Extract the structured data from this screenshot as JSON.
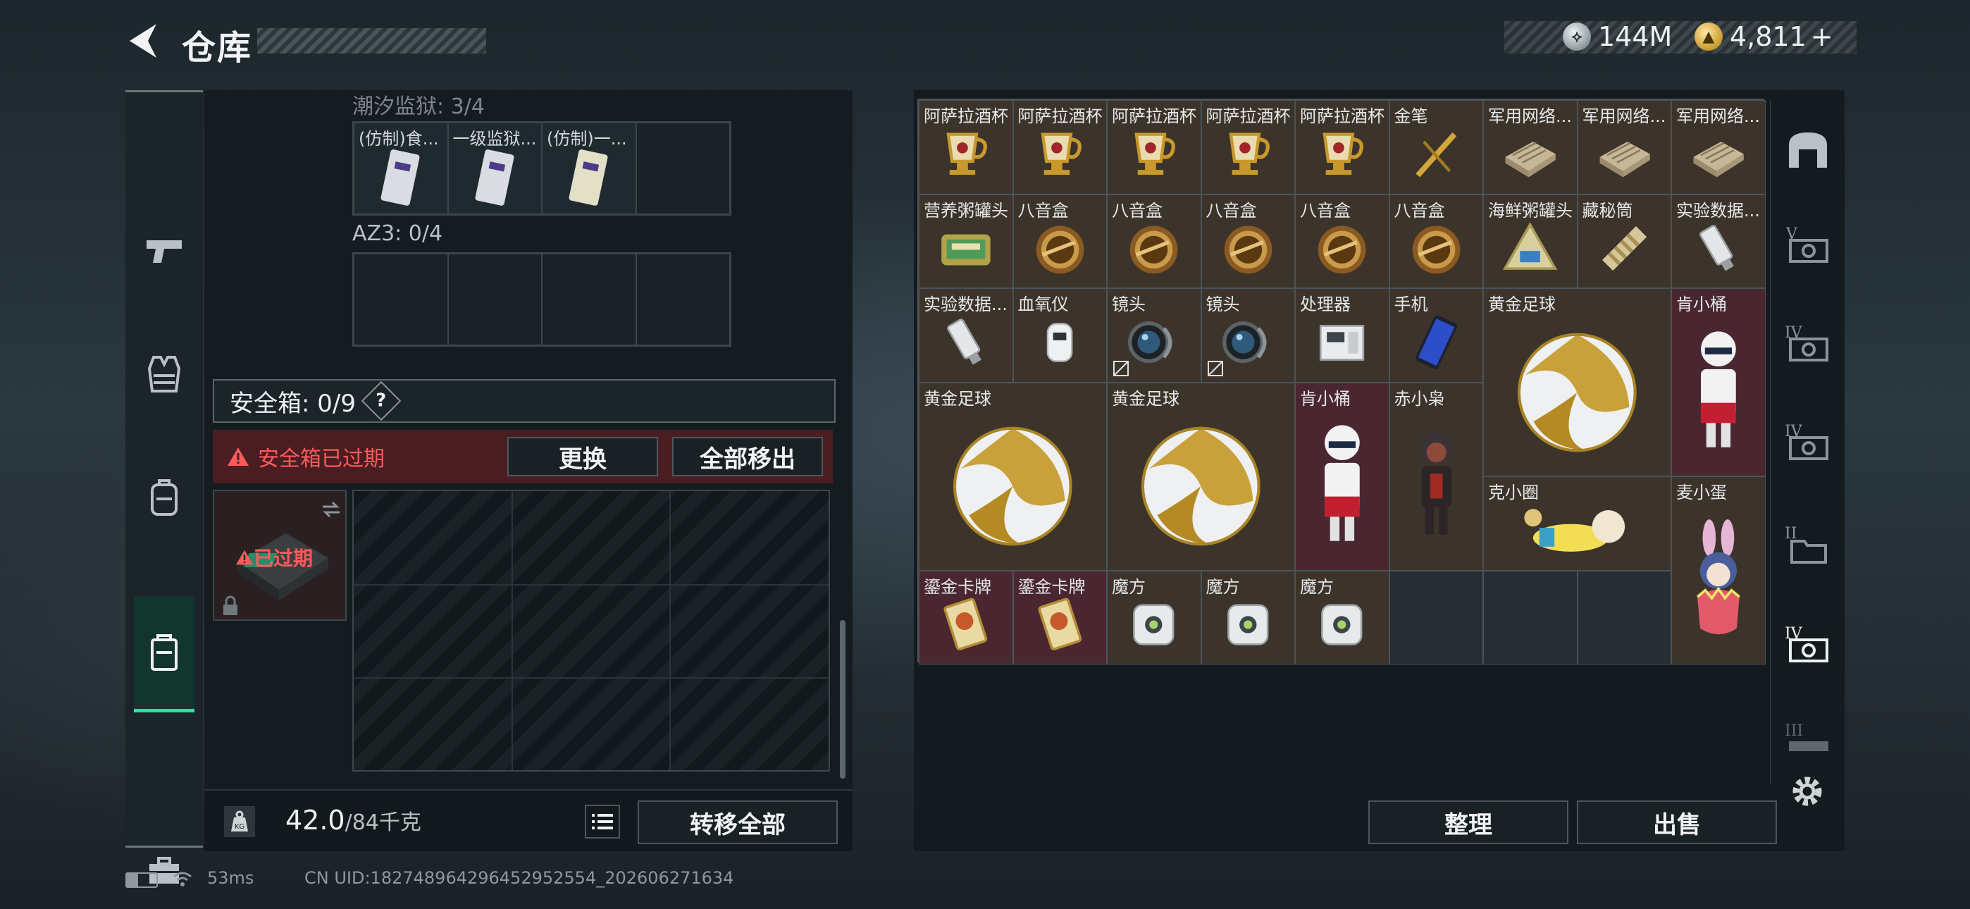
{
  "header": {
    "title": "仓库",
    "currency": [
      {
        "value": "144M"
      },
      {
        "value": "4,811"
      }
    ],
    "add_symbol": "+"
  },
  "left": {
    "tidal_label": "潮汐监狱: 3/4",
    "tidal_items": [
      {
        "label": "(仿制)食..."
      },
      {
        "label": "一级监狱..."
      },
      {
        "label": "(仿制)一..."
      },
      {
        "label": ""
      }
    ],
    "az3_label": "AZ3: 0/4",
    "safebox_label": "安全箱: 0/9",
    "safebox_help": "?",
    "expired_warning": "安全箱已过期",
    "replace_button": "更换",
    "move_all_button": "全部移出",
    "expired_tag": "已过期",
    "weight_value": "42.0",
    "weight_max": "/84千克",
    "transfer_all_button": "转移全部"
  },
  "right": {
    "items": [
      {
        "label": "阿萨拉酒杯",
        "col": 1,
        "row": 1,
        "w": 1,
        "h": 1,
        "bg": "gold",
        "icon": "goblet"
      },
      {
        "label": "阿萨拉酒杯",
        "col": 2,
        "row": 1,
        "w": 1,
        "h": 1,
        "bg": "gold",
        "icon": "goblet"
      },
      {
        "label": "阿萨拉酒杯",
        "col": 3,
        "row": 1,
        "w": 1,
        "h": 1,
        "bg": "gold",
        "icon": "goblet"
      },
      {
        "label": "阿萨拉酒杯",
        "col": 4,
        "row": 1,
        "w": 1,
        "h": 1,
        "bg": "gold",
        "icon": "goblet"
      },
      {
        "label": "阿萨拉酒杯",
        "col": 5,
        "row": 1,
        "w": 1,
        "h": 1,
        "bg": "gold",
        "icon": "goblet"
      },
      {
        "label": "金笔",
        "col": 6,
        "row": 1,
        "w": 1,
        "h": 1,
        "bg": "gold",
        "icon": "pen"
      },
      {
        "label": "军用网络...",
        "col": 7,
        "row": 1,
        "w": 1,
        "h": 1,
        "bg": "gold",
        "icon": "router"
      },
      {
        "label": "军用网络...",
        "col": 8,
        "row": 1,
        "w": 1,
        "h": 1,
        "bg": "gold",
        "icon": "router"
      },
      {
        "label": "军用网络...",
        "col": 9,
        "row": 1,
        "w": 1,
        "h": 1,
        "bg": "gold",
        "icon": "router"
      },
      {
        "label": "营养粥罐头",
        "col": 1,
        "row": 2,
        "w": 1,
        "h": 1,
        "bg": "gold",
        "icon": "can"
      },
      {
        "label": "八音盒",
        "col": 2,
        "row": 2,
        "w": 1,
        "h": 1,
        "bg": "gold",
        "icon": "musicbox"
      },
      {
        "label": "八音盒",
        "col": 3,
        "row": 2,
        "w": 1,
        "h": 1,
        "bg": "gold",
        "icon": "musicbox"
      },
      {
        "label": "八音盒",
        "col": 4,
        "row": 2,
        "w": 1,
        "h": 1,
        "bg": "gold",
        "icon": "musicbox"
      },
      {
        "label": "八音盒",
        "col": 5,
        "row": 2,
        "w": 1,
        "h": 1,
        "bg": "gold",
        "icon": "musicbox"
      },
      {
        "label": "八音盒",
        "col": 6,
        "row": 2,
        "w": 1,
        "h": 1,
        "bg": "gold",
        "icon": "musicbox"
      },
      {
        "label": "海鲜粥罐头",
        "col": 7,
        "row": 2,
        "w": 1,
        "h": 1,
        "bg": "gold",
        "icon": "pyramid"
      },
      {
        "label": "藏秘筒",
        "col": 8,
        "row": 2,
        "w": 1,
        "h": 1,
        "bg": "gold",
        "icon": "cryptex"
      },
      {
        "label": "实验数据...",
        "col": 9,
        "row": 2,
        "w": 1,
        "h": 1,
        "bg": "gold",
        "icon": "usb"
      },
      {
        "label": "实验数据...",
        "col": 1,
        "row": 3,
        "w": 1,
        "h": 1,
        "bg": "gold",
        "icon": "usb"
      },
      {
        "label": "血氧仪",
        "col": 2,
        "row": 3,
        "w": 1,
        "h": 1,
        "bg": "gold",
        "icon": "oximeter"
      },
      {
        "label": "镜头",
        "col": 3,
        "row": 3,
        "w": 1,
        "h": 1,
        "bg": "gold",
        "icon": "lens"
      },
      {
        "label": "镜头",
        "col": 4,
        "row": 3,
        "w": 1,
        "h": 1,
        "bg": "gold",
        "icon": "lens"
      },
      {
        "label": "处理器",
        "col": 5,
        "row": 3,
        "w": 1,
        "h": 1,
        "bg": "gold",
        "icon": "processor"
      },
      {
        "label": "手机",
        "col": 6,
        "row": 3,
        "w": 1,
        "h": 1,
        "bg": "gold",
        "icon": "phone"
      },
      {
        "label": "黄金足球",
        "col": 7,
        "row": 3,
        "w": 2,
        "h": 2,
        "bg": "gold",
        "icon": "ball"
      },
      {
        "label": "肯小桶",
        "col": 9,
        "row": 3,
        "w": 1,
        "h": 2,
        "bg": "red",
        "icon": "figure-white"
      },
      {
        "label": "黄金足球",
        "col": 1,
        "row": 4,
        "w": 2,
        "h": 2,
        "bg": "gold",
        "icon": "ball"
      },
      {
        "label": "黄金足球",
        "col": 3,
        "row": 4,
        "w": 2,
        "h": 2,
        "bg": "gold",
        "icon": "ball"
      },
      {
        "label": "肯小桶",
        "col": 5,
        "row": 4,
        "w": 1,
        "h": 2,
        "bg": "red",
        "icon": "figure-white"
      },
      {
        "label": "赤小枭",
        "col": 6,
        "row": 4,
        "w": 1,
        "h": 2,
        "bg": "gold",
        "icon": "figure-dark"
      },
      {
        "label": "克小圈",
        "col": 7,
        "row": 5,
        "w": 2,
        "h": 1,
        "bg": "gold",
        "icon": "figure-lying"
      },
      {
        "label": "麦小蛋",
        "col": 9,
        "row": 5,
        "w": 1,
        "h": 2,
        "bg": "gold",
        "icon": "figure-egg"
      },
      {
        "label": "鎏金卡牌",
        "col": 1,
        "row": 6,
        "w": 1,
        "h": 1,
        "bg": "red",
        "icon": "card"
      },
      {
        "label": "鎏金卡牌",
        "col": 2,
        "row": 6,
        "w": 1,
        "h": 1,
        "bg": "red",
        "icon": "card"
      },
      {
        "label": "魔方",
        "col": 3,
        "row": 6,
        "w": 1,
        "h": 1,
        "bg": "gold",
        "icon": "cube"
      },
      {
        "label": "魔方",
        "col": 4,
        "row": 6,
        "w": 1,
        "h": 1,
        "bg": "gold",
        "icon": "cube"
      },
      {
        "label": "魔方",
        "col": 5,
        "row": 6,
        "w": 1,
        "h": 1,
        "bg": "gold",
        "icon": "cube"
      }
    ],
    "tidy_button": "整理",
    "sell_button": "出售"
  },
  "status": {
    "ping": "53ms",
    "uid": "CN UID:18274896429645295​2554_202606271634"
  },
  "colors": {
    "accent_green": "#2de3a4",
    "warning_red": "#ff5a5a",
    "gold_cell": "#3c342a",
    "red_cell": "#4a2730"
  }
}
